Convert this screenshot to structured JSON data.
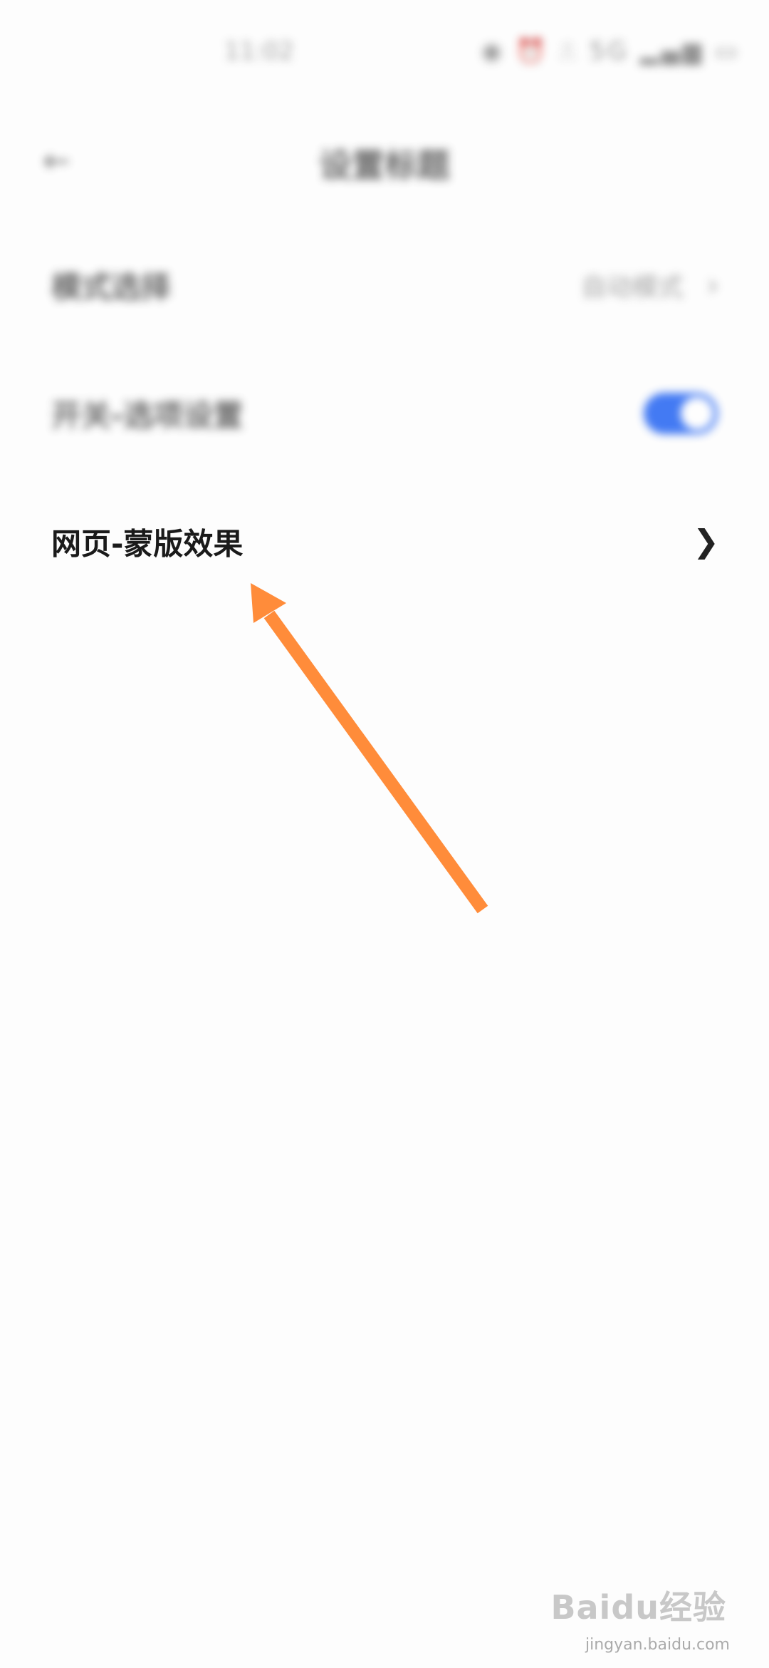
{
  "status_bar": {
    "time": "11:02",
    "icons": "◉ ⏰ ⎍ 5G ▂▄▆ ▭"
  },
  "header": {
    "back_icon": "back-arrow-icon",
    "title": "设置标题"
  },
  "settings": [
    {
      "label": "模式选择",
      "value": "自动模式",
      "control": "chevron"
    },
    {
      "label": "开关-选项设置",
      "control": "toggle",
      "toggle_on": true,
      "toggle_color": "#2f6cf2"
    },
    {
      "label": "网页-蒙版效果",
      "control": "chevron"
    }
  ],
  "annotation": {
    "color": "#ff8c3a"
  },
  "watermark": {
    "brand": "Baidu经验",
    "url": "jingyan.baidu.com"
  }
}
